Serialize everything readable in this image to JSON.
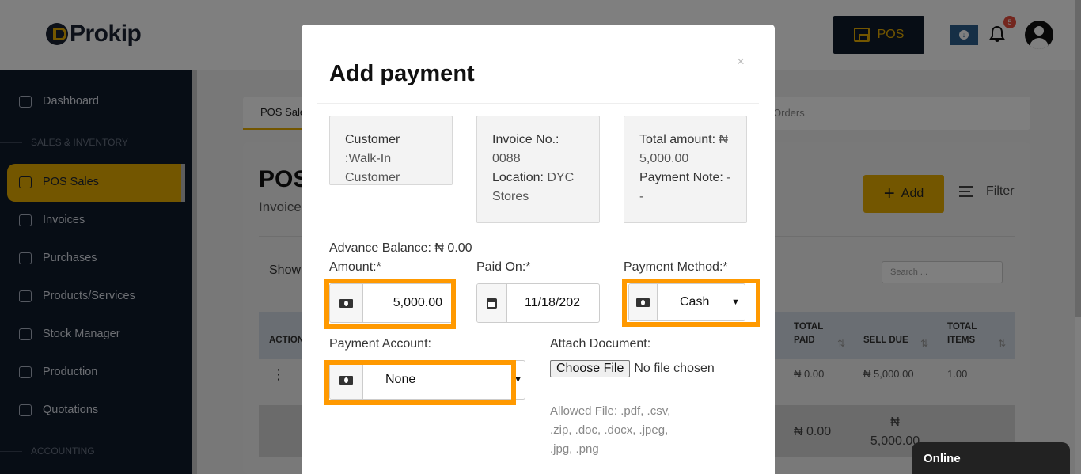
{
  "app": {
    "brand": "Prokip",
    "pos_label": "POS",
    "notifications_count": "5"
  },
  "sidebar": {
    "items": [
      {
        "label": "Dashboard",
        "icon": "home-icon"
      },
      {
        "label": "POS Sales",
        "icon": "cart-icon",
        "active": true
      },
      {
        "label": "Invoices",
        "icon": "invoice-icon"
      },
      {
        "label": "Purchases",
        "icon": "box-icon"
      },
      {
        "label": "Products/Services",
        "icon": "cube-icon"
      },
      {
        "label": "Stock Manager",
        "icon": "stock-icon"
      },
      {
        "label": "Production",
        "icon": "factory-icon"
      },
      {
        "label": "Quotations",
        "icon": "quote-icon"
      }
    ],
    "sections": [
      "SALES & INVENTORY",
      "ACCOUNTING"
    ]
  },
  "main": {
    "tab_pos": "POS Sale",
    "tab_orders": "Orders",
    "title": "POS",
    "subtitle": "Invoice",
    "add_label": "Add",
    "filter_label": "Filter",
    "show_label": "Show",
    "search_placeholder": "Search ...",
    "columns": {
      "action": "ACTION",
      "total_paid": [
        "TOTAL",
        "PAID"
      ],
      "sell_due": "SELL DUE",
      "total_items": [
        "TOTAL",
        "ITEMS"
      ]
    },
    "row": {
      "menu": "⋮",
      "total_paid": "₦ 0.00",
      "sell_due": "₦ 5,000.00",
      "total_items": "1.00"
    },
    "footer": {
      "total_paid": "₦ 0.00",
      "sell_due_sym": "₦",
      "sell_due": "5,000.00"
    }
  },
  "modal": {
    "title": "Add payment",
    "close": "×",
    "customer_label": "Customer :",
    "customer_value": "Walk-In Customer",
    "invoice_label": "Invoice No.:",
    "invoice_value": "0088",
    "location_label": "Location:",
    "location_value": "DYC Stores",
    "total_label": "Total amount:",
    "total_value": "₦ 5,000.00",
    "note_label": "Payment Note:",
    "note_value": "- -",
    "advance_balance": "Advance Balance: ₦ 0.00",
    "amount_label": "Amount:*",
    "amount_value": "5,000.00",
    "paid_on_label": "Paid On:*",
    "paid_on_value": "11/18/202",
    "method_label": "Payment Method:*",
    "method_value": "Cash",
    "account_label": "Payment Account:",
    "account_value": "None",
    "attach_label": "Attach Document:",
    "choose_file": "Choose File",
    "no_file": "No file chosen",
    "allowed": "Allowed File: .pdf, .csv, .zip, .doc, .docx, .jpeg, .jpg, .png"
  },
  "chat": {
    "status": "Online"
  },
  "colors": {
    "accent": "#e6ac00",
    "navy": "#0f1a2a",
    "highlight": "#ff9900"
  }
}
